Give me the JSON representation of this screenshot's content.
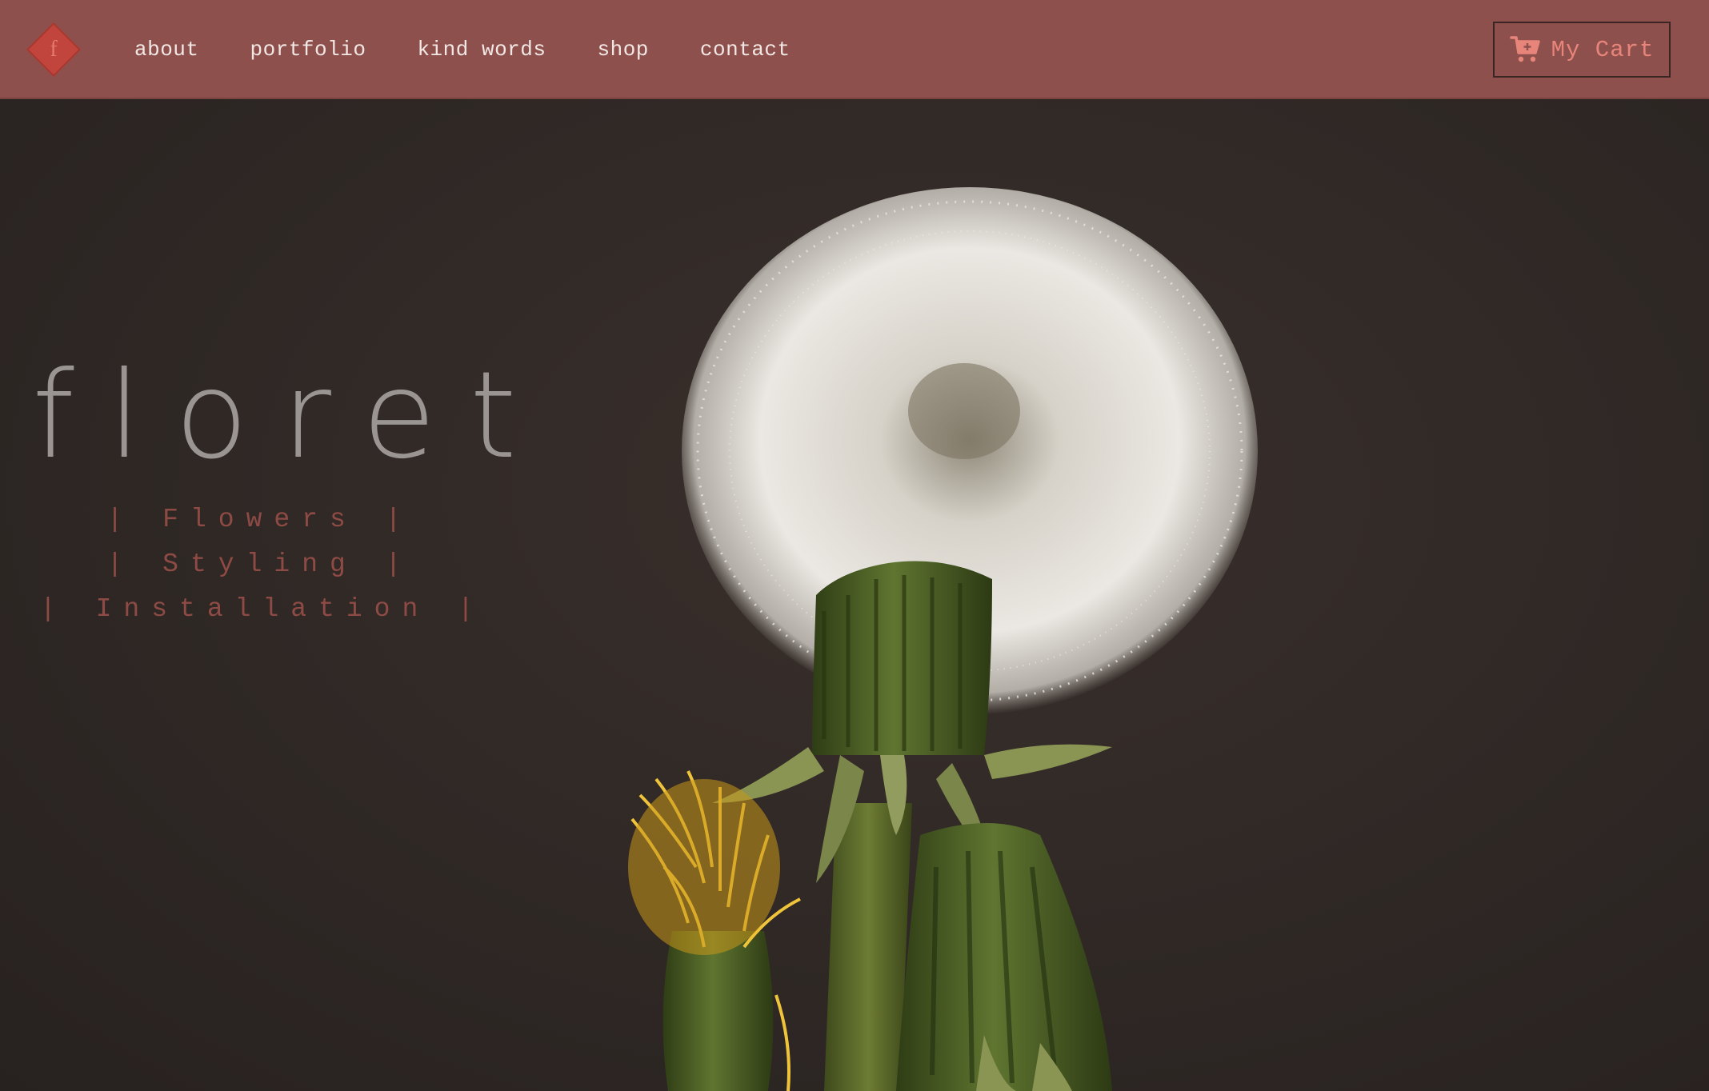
{
  "brand": {
    "logo_letter": "f",
    "hero_title": "floret",
    "taglines": [
      "| Flowers |",
      "| Styling |",
      "| Installation |"
    ]
  },
  "nav": {
    "items": [
      {
        "label": "about"
      },
      {
        "label": "portfolio"
      },
      {
        "label": "kind words"
      },
      {
        "label": "shop"
      },
      {
        "label": "contact"
      }
    ]
  },
  "cart": {
    "label": "My Cart",
    "icon": "shopping-cart-icon"
  },
  "colors": {
    "navbar": "#8e504c",
    "accent": "#e8857b",
    "logo": "#c1453c",
    "background": "#2e2724",
    "title": "#9a9592",
    "tagline": "#8e4a44"
  },
  "hero_image": {
    "icon": "dandelion-photo"
  }
}
